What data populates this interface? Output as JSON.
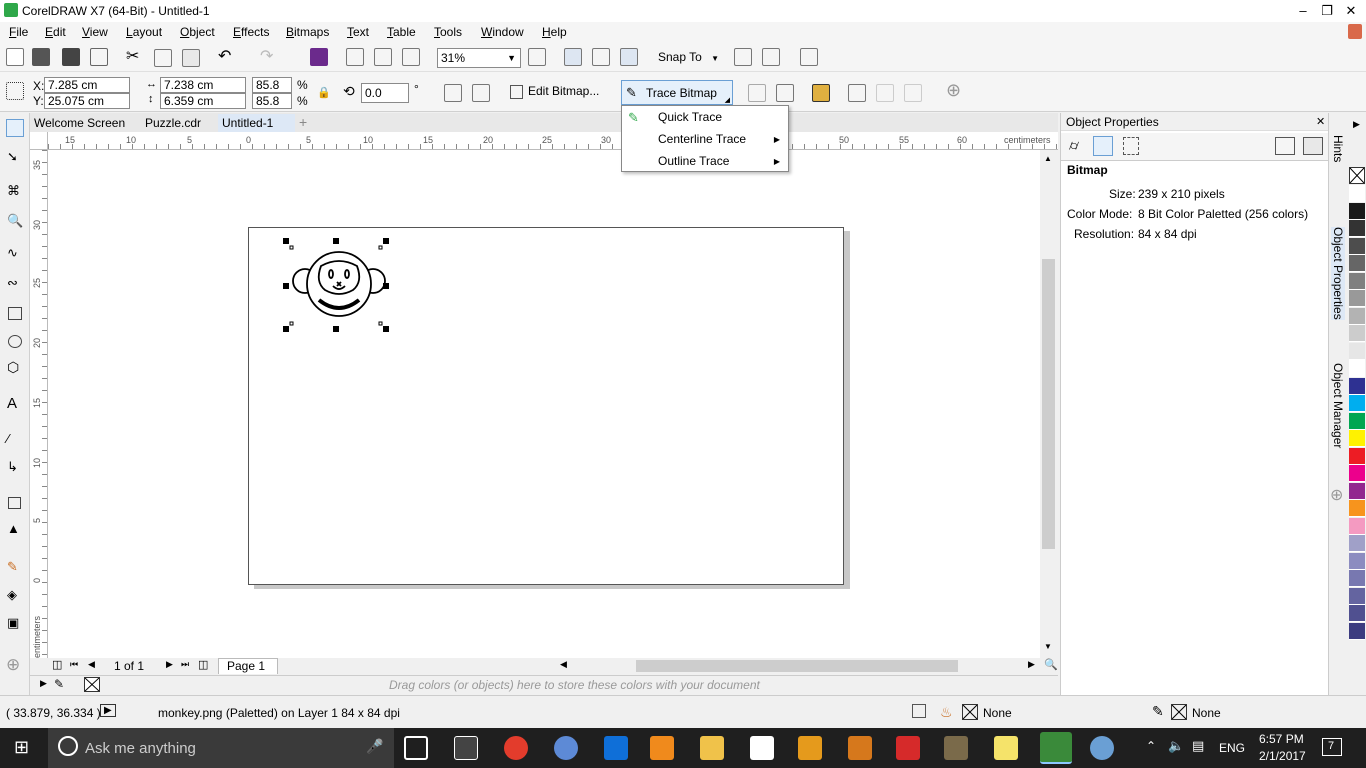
{
  "titlebar": {
    "title": "CorelDRAW X7 (64-Bit) - Untitled-1"
  },
  "menu": [
    "File",
    "Edit",
    "View",
    "Layout",
    "Object",
    "Effects",
    "Bitmaps",
    "Text",
    "Table",
    "Tools",
    "Window",
    "Help"
  ],
  "toolbar": {
    "zoom": "31%",
    "snap_to": "Snap To"
  },
  "propbar": {
    "x": "7.285 cm",
    "y": "25.075 cm",
    "w": "7.238 cm",
    "h": "6.359 cm",
    "sx": "85.8",
    "sy": "85.8",
    "pct": "%",
    "angle": "0.0",
    "deg": "°",
    "edit_bitmap": "Edit Bitmap...",
    "trace_bitmap": "Trace Bitmap"
  },
  "trace_menu": {
    "quick": "Quick Trace",
    "centerline": "Centerline Trace",
    "outline": "Outline Trace"
  },
  "tabs": [
    "Welcome Screen",
    "Puzzle.cdr",
    "Untitled-1"
  ],
  "ruler": {
    "unit": "centimeters",
    "h_labels": [
      "15",
      "10",
      "5",
      "0",
      "5",
      "10",
      "15",
      "20",
      "25",
      "30",
      "35",
      "40",
      "45",
      "50",
      "55",
      "60"
    ],
    "v_labels": [
      "35",
      "30",
      "25",
      "20",
      "15",
      "10",
      "5",
      "0"
    ]
  },
  "pagenav": {
    "count": "1 of 1",
    "page_tab": "Page 1"
  },
  "colorwell": {
    "hint": "Drag colors (or objects) here to store these colors with your document"
  },
  "docker": {
    "title": "Object Properties",
    "section": "Bitmap",
    "size_label": "Size:",
    "size_value": "239 x 210 pixels",
    "mode_label": "Color Mode:",
    "mode_value": "8 Bit Color  Paletted (256 colors)",
    "res_label": "Resolution:",
    "res_value": "84 x 84 dpi",
    "tabs": [
      "Hints",
      "Object Properties",
      "Object Manager"
    ]
  },
  "palette": [
    "#ffffff",
    "#1a1a1a",
    "#333333",
    "#4d4d4d",
    "#666666",
    "#808080",
    "#999999",
    "#b3b3b3",
    "#cccccc",
    "#e6e6e6",
    "#ffffff",
    "#2e3192",
    "#00aeef",
    "#00a651",
    "#fff200",
    "#ed1c24",
    "#ec008c",
    "#92278f",
    "#f7941d",
    "#f49ac1",
    "#a0a0c8",
    "#8c8cc0",
    "#7878b0",
    "#6464a0",
    "#505090",
    "#3c3c80"
  ],
  "status": {
    "coords": "( 33.879, 36.334 )",
    "object": "monkey.png (Paletted) on Layer 1 84 x 84 dpi",
    "fill": "None",
    "outline": "None"
  },
  "taskbar": {
    "search": "Ask me anything",
    "lang": "ENG",
    "time": "6:57 PM",
    "date": "2/1/2017",
    "notifications": "7"
  }
}
